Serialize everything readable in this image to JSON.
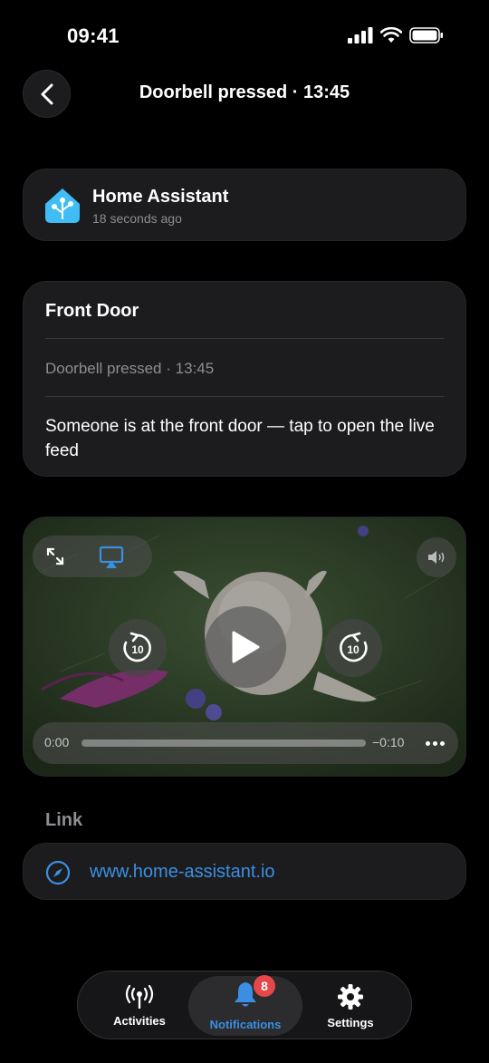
{
  "status_bar": {
    "time": "09:41"
  },
  "header": {
    "title": "Doorbell pressed · 13:45",
    "back_icon": "chevron-left-icon"
  },
  "source": {
    "app_name": "Home Assistant",
    "time_ago": "18 seconds ago",
    "logo_color": "#41bdf5"
  },
  "message": {
    "title": "Front Door",
    "subtitle": "Doorbell pressed · 13:45",
    "body": "Someone is at the front door — tap to open the live feed"
  },
  "video": {
    "current_time": "0:00",
    "remaining_time": "−0:10",
    "skip_back_label": "10",
    "skip_forward_label": "10",
    "progress": 0
  },
  "link": {
    "section_label": "Link",
    "url": "www.home-assistant.io",
    "icon": "compass-icon"
  },
  "tab_bar": {
    "tabs": [
      {
        "label": "Activities",
        "icon": "antenna-icon"
      },
      {
        "label": "Notifications",
        "icon": "bell-icon",
        "badge": "8",
        "selected": true
      },
      {
        "label": "Settings",
        "icon": "gear-icon"
      }
    ]
  },
  "colors": {
    "accent": "#3b8fe3",
    "badge": "#e5474a",
    "card": "#1c1c1e"
  }
}
